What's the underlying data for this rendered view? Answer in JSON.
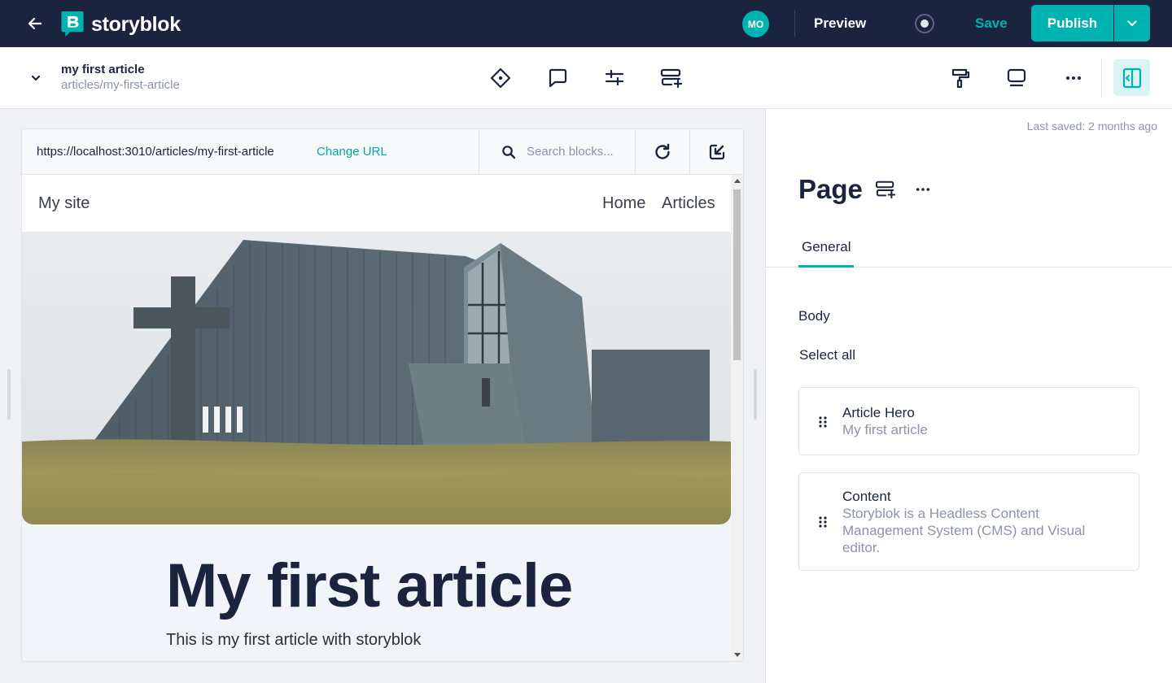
{
  "app": {
    "logo_text": "storyblok",
    "avatar_initials": "MO",
    "preview_label": "Preview",
    "save_label": "Save",
    "publish_label": "Publish",
    "accent_color": "#00b3b0",
    "topbar_color": "#1b243f"
  },
  "story": {
    "title": "my first article",
    "slug": "articles/my-first-article"
  },
  "preview": {
    "url": "https://localhost:3010/articles/my-first-article",
    "change_url_label": "Change URL",
    "search_placeholder": "Search blocks..."
  },
  "site": {
    "brand": "My site",
    "nav": [
      "Home",
      "Articles"
    ],
    "article_title": "My first article",
    "article_subtitle": "This is my first article with storyblok"
  },
  "panel": {
    "last_saved": "Last saved: 2 months ago",
    "title": "Page",
    "tabs": [
      "General"
    ],
    "field_label": "Body",
    "select_all": "Select all",
    "blocks": [
      {
        "name": "Article Hero",
        "description": "My first article"
      },
      {
        "name": "Content",
        "description": "Storyblok is a Headless Content Management System (CMS) and Visual editor."
      }
    ]
  }
}
